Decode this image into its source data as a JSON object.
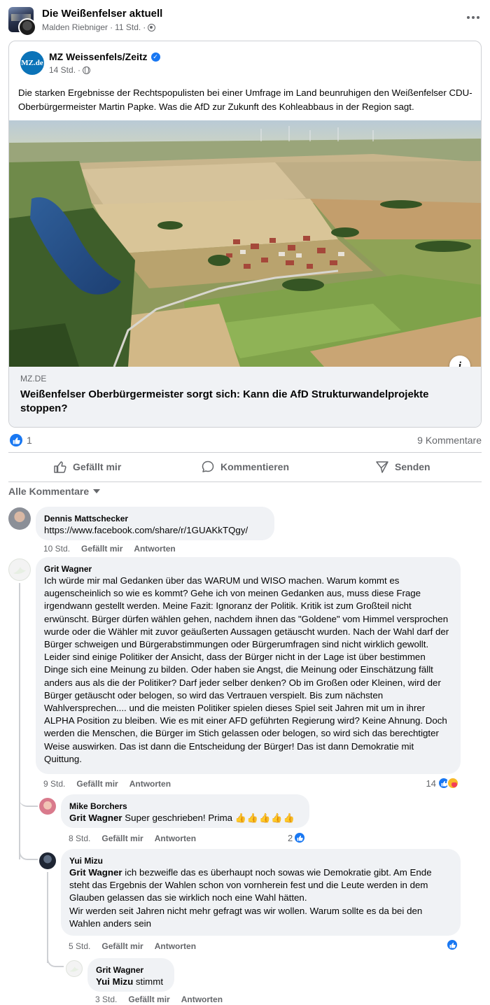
{
  "group": {
    "title": "Die Weißenfelser aktuell",
    "author": "Malden Riebniger",
    "time": "11 Std.",
    "separator": "·"
  },
  "shared_post": {
    "page_name": "MZ Weissenfels/Zeitz",
    "logo_text": "MZ.de",
    "time": "14 Std.",
    "separator": "·",
    "text": "Die starken Ergebnisse der Rechtspopulisten bei einer Umfrage im Land beunruhigen den Weißenfelser CDU-Oberbürgermeister Martin Papke. Was die AfD zur Zukunft des Kohleabbaus in der Region sagt.",
    "info_label": "i",
    "link": {
      "domain": "MZ.DE",
      "title": "Weißenfelser Oberbürgermeister sorgt sich: Kann die AfD Strukturwandelprojekte stoppen?"
    }
  },
  "reactions": {
    "count": "1",
    "comments": "9 Kommentare"
  },
  "actions": {
    "like": "Gefällt mir",
    "comment": "Kommentieren",
    "share": "Senden"
  },
  "filter": {
    "label": "Alle Kommentare"
  },
  "comments": [
    {
      "author": "Dennis Mattschecker",
      "text": "https://www.facebook.com/share/r/1GUAKkTQgy/",
      "time": "10 Std.",
      "like": "Gefällt mir",
      "reply": "Antworten"
    },
    {
      "author": "Grit Wagner",
      "text": "Ich würde mir mal Gedanken über das WARUM und WISO machen. Warum kommt es augenscheinlich so wie es kommt? Gehe ich von meinen Gedanken aus, muss diese Frage irgendwann gestellt werden. Meine Fazit: Ignoranz der Politik. Kritik ist zum Großteil nicht erwünscht. Bürger dürfen wählen gehen, nachdem ihnen das \"Goldene\" vom Himmel versprochen wurde oder die Wähler mit zuvor geäußerten Aussagen getäuscht wurden. Nach der Wahl darf der Bürger schweigen und Bürgerabstimmungen oder Bürgerumfragen sind nicht wirklich gewollt. Leider sind einige Politiker der Ansicht, dass der Bürger nicht in der Lage ist über bestimmen Dinge sich eine Meinung zu bilden. Oder haben sie Angst, die Meinung oder Einschätzung fällt anders aus als die der Politiker? Darf jeder selber denken? Ob im Großen oder Kleinen, wird der Bürger getäuscht oder belogen, so wird das Vertrauen verspielt. Bis zum nächsten Wahlversprechen.... und die meisten Politiker spielen dieses Spiel seit Jahren mit um in ihrer ALPHA Position zu bleiben. Wie es mit einer AFD geführten Regierung wird? Keine Ahnung. Doch werden die Menschen, die Bürger im Stich gelassen oder belogen, so wird sich das berechtigter Weise auswirken. Das ist dann die Entscheidung der Bürger! Das ist dann Demokratie mit Quittung.",
      "time": "9 Std.",
      "like": "Gefällt mir",
      "reply": "Antworten",
      "reaction_count": "14",
      "replies": [
        {
          "author": "Mike Borchers",
          "mention": "Grit Wagner",
          "text": " Super geschrieben! Prima ",
          "emoji": "👍👍👍👍👍",
          "time": "8 Std.",
          "like": "Gefällt mir",
          "reply": "Antworten",
          "reaction_count": "2"
        },
        {
          "author": "Yui Mizu",
          "mention": "Grit Wagner",
          "text": " ich bezweifle das es überhaupt noch sowas wie Demokratie gibt. Am Ende steht das Ergebnis der Wahlen schon von vornherein fest und die Leute werden in dem Glauben gelassen das sie wirklich noch eine Wahl hätten.",
          "text2": "Wir werden seit Jahren nicht mehr gefragt was wir wollen. Warum sollte es da bei den Wahlen anders sein",
          "time": "5 Std.",
          "like": "Gefällt mir",
          "reply": "Antworten"
        },
        {
          "author": "Grit Wagner",
          "mention": "Yui Mizu",
          "text": " stimmt",
          "time": "3 Std.",
          "like": "Gefällt mir",
          "reply": "Antworten"
        }
      ]
    }
  ],
  "colors": {
    "brand_blue": "#1877f2",
    "secondary_text": "#65676b",
    "bubble_bg": "#f0f2f5",
    "divider": "#ced0d4"
  },
  "icons": [
    "more-icon",
    "group-icon",
    "verified-icon",
    "globe-icon",
    "info-icon",
    "like-reaction-icon",
    "like-icon",
    "comment-icon",
    "send-icon",
    "caret-down-icon",
    "care-reaction-icon"
  ]
}
